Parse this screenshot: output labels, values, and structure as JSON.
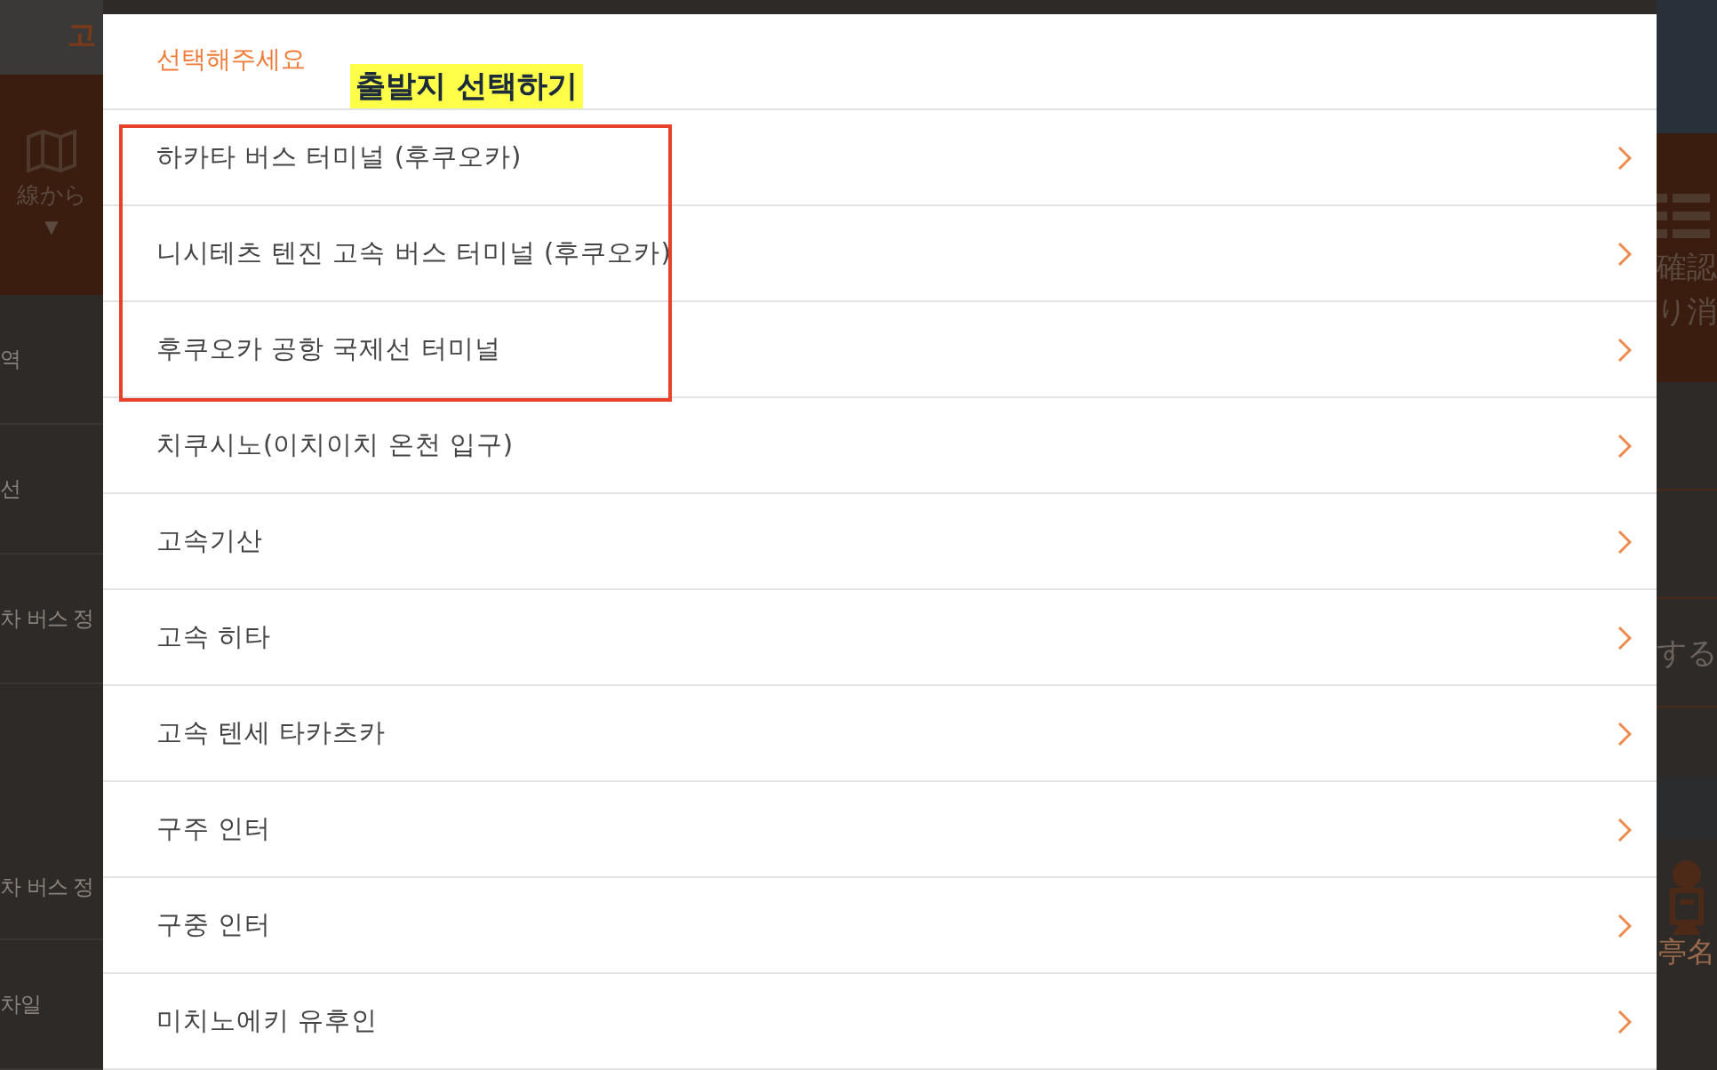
{
  "background_left": {
    "top_fragment": "고",
    "panel_label": "線から",
    "panel_caret": "▼",
    "rows": [
      "역",
      "선",
      "차 버스 정",
      "차 버스 정",
      "차일"
    ]
  },
  "background_right": {
    "panel_lines": [
      "確認",
      "り消"
    ],
    "row_text": "する",
    "bottom_label": "亭名"
  },
  "modal": {
    "title": "선택해주세요",
    "options": [
      {
        "label": "하카타 버스 터미널 (후쿠오카)",
        "marked": true
      },
      {
        "label": "니시테츠 텐진 고속 버스 터미널 (후쿠오카)",
        "marked": true
      },
      {
        "label": "후쿠오카 공항 국제선 터미널",
        "marked": true
      },
      {
        "label": "치쿠시노(이치이치 온천 입구)",
        "marked": false
      },
      {
        "label": "고속기산",
        "marked": false
      },
      {
        "label": "고속 히타",
        "marked": false
      },
      {
        "label": "고속 텐세 타카츠카",
        "marked": false
      },
      {
        "label": "구주 인터",
        "marked": false
      },
      {
        "label": "구중 인터",
        "marked": false
      },
      {
        "label": "미치노에키 유후인",
        "marked": false
      }
    ]
  },
  "annotation": {
    "label": "출발지 선택하기"
  }
}
